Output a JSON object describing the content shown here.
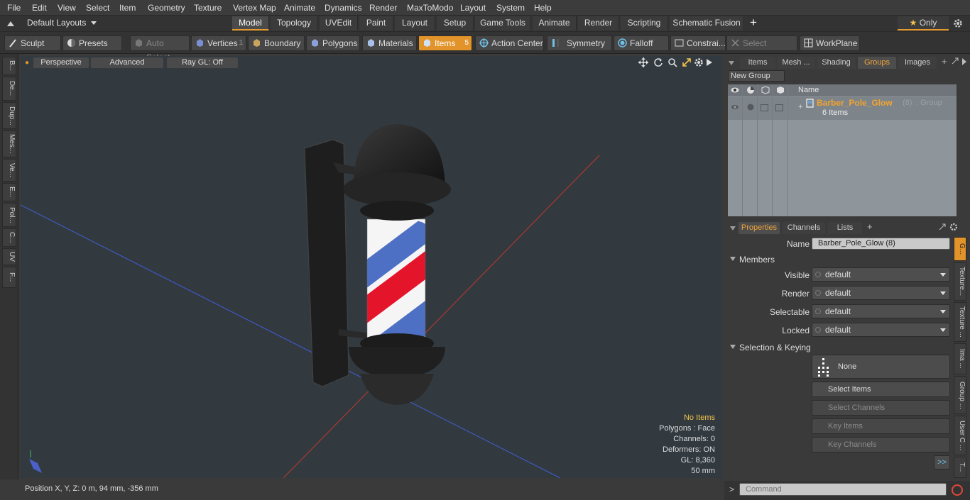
{
  "menu": [
    "File",
    "Edit",
    "View",
    "Select",
    "Item",
    "Geometry",
    "Texture",
    "Vertex Map",
    "Animate",
    "Dynamics",
    "Render",
    "MaxToModo",
    "Layout",
    "System",
    "Help"
  ],
  "layout": {
    "label": "Default Layouts"
  },
  "tabs": [
    {
      "label": "Model",
      "active": true
    },
    {
      "label": "Topology"
    },
    {
      "label": "UVEdit"
    },
    {
      "label": "Paint"
    },
    {
      "label": "Layout"
    },
    {
      "label": "Setup"
    },
    {
      "label": "Game Tools"
    },
    {
      "label": "Animate"
    },
    {
      "label": "Render"
    },
    {
      "label": "Scripting"
    },
    {
      "label": "Schematic Fusion"
    }
  ],
  "only_label": "Only",
  "toolbar": {
    "sculpt": "Sculpt",
    "presets": "Presets",
    "auto_select": "Auto Select",
    "vertices": "Vertices",
    "vertices_count": "1",
    "boundary": "Boundary",
    "polygons": "Polygons",
    "materials": "Materials",
    "items": "Items",
    "items_count": "5",
    "action_center": "Action Center",
    "symmetry": "Symmetry",
    "falloff": "Falloff",
    "constraints": "Constrai...",
    "select_through": "Select Through",
    "workplane": "WorkPlane"
  },
  "left_tabs": [
    "B...",
    "De...",
    "Dup...",
    "Mes...",
    "Ve...",
    "E...",
    "Pol...",
    "C...",
    "UV",
    "F..."
  ],
  "viewport": {
    "perspective": "Perspective",
    "advanced": "Advanced",
    "raygl": "Ray GL: Off",
    "info": {
      "items": "No Items",
      "polygons": "Polygons : Face",
      "channels": "Channels: 0",
      "deformers": "Deformers: ON",
      "gl": "GL: 8,360",
      "scale": "50 mm"
    }
  },
  "status": {
    "position": "Position X, Y, Z:   0 m, 94 mm, -356 mm"
  },
  "colors": {
    "accent": "#e2942a",
    "pole_red": "#e4142b",
    "pole_blue": "#4d70c4"
  },
  "item_panel": {
    "tabs": [
      {
        "label": "Items"
      },
      {
        "label": "Mesh ..."
      },
      {
        "label": "Shading"
      },
      {
        "label": "Groups",
        "active": true
      },
      {
        "label": "Images"
      }
    ],
    "new_group": "New Group",
    "col_name": "Name",
    "group": {
      "name": "Barber_Pole_Glow",
      "count": "(8)",
      "type": ": Group",
      "items": "6 Items"
    }
  },
  "properties": {
    "tabs": [
      {
        "label": "Properties",
        "active": true
      },
      {
        "label": "Channels"
      },
      {
        "label": "Lists"
      }
    ],
    "name_label": "Name",
    "name_value": "Barber_Pole_Glow (8)",
    "members": "Members",
    "visible_label": "Visible",
    "visible": "default",
    "render_label": "Render",
    "render": "default",
    "selectable_label": "Selectable",
    "selectable": "default",
    "locked_label": "Locked",
    "locked": "default",
    "selection_keying": "Selection & Keying",
    "none": "None",
    "select_items": "Select Items",
    "select_channels": "Select Channels",
    "key_items": "Key Items",
    "key_channels": "Key Channels",
    "more": ">>"
  },
  "side_tabs": [
    "G...",
    "Texture...",
    "Texture ...",
    "Ima ...",
    "Group ...",
    "User C ...",
    "T..."
  ],
  "command": {
    "placeholder": "Command"
  }
}
